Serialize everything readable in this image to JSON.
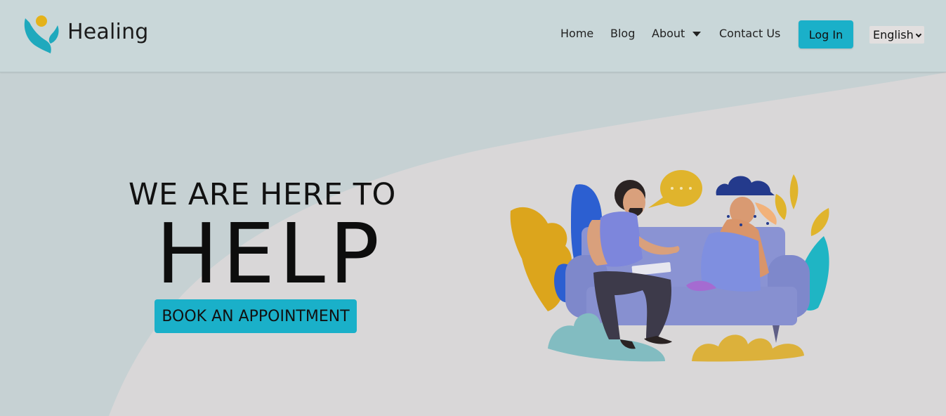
{
  "brand": {
    "name": "Healing",
    "logo": "healing-figure-logo"
  },
  "nav": {
    "home": "Home",
    "blog": "Blog",
    "about": "About",
    "contact": "Contact Us",
    "login": "Log In",
    "language": "English"
  },
  "hero": {
    "line1": "WE ARE HERE TO",
    "big": "HELP",
    "cta": "BOOK AN APPOINTMENT",
    "illustration": "therapy-session-illustration"
  },
  "colors": {
    "accent": "#1ab0c9",
    "header_bg": "#c9d7d9",
    "page_bg": "#d9d7d8",
    "wave_bg": "#c6d1d3"
  }
}
